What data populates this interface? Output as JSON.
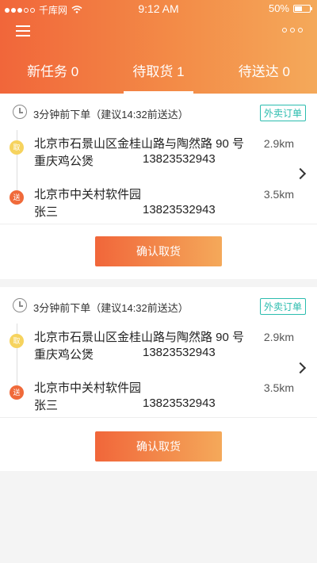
{
  "status_bar": {
    "carrier": "千库网",
    "time": "9:12 AM",
    "battery": "50%"
  },
  "header": {
    "menu_icon": "menu-icon",
    "more_icon": "more-icon"
  },
  "tabs": [
    {
      "label": "新任务 0",
      "active": false
    },
    {
      "label": "待取货 1",
      "active": true
    },
    {
      "label": "待送达 0",
      "active": false
    }
  ],
  "orders": [
    {
      "time_text": "3分钟前下单（建议14:32前送达）",
      "tag": "外卖订单",
      "pickup": {
        "badge": "取",
        "address": "北京市石景山区金桂山路与陶然路 90 号",
        "name": "重庆鸡公煲",
        "phone": "13823532943",
        "distance": "2.9km"
      },
      "dropoff": {
        "badge": "送",
        "address": "北京市中关村软件园",
        "name": "张三",
        "phone": "13823532943",
        "distance": "3.5km"
      },
      "button": "确认取货"
    },
    {
      "time_text": "3分钟前下单（建议14:32前送达）",
      "tag": "外卖订单",
      "pickup": {
        "badge": "取",
        "address": "北京市石景山区金桂山路与陶然路 90 号",
        "name": "重庆鸡公煲",
        "phone": "13823532943",
        "distance": "2.9km"
      },
      "dropoff": {
        "badge": "送",
        "address": "北京市中关村软件园",
        "name": "张三",
        "phone": "13823532943",
        "distance": "3.5km"
      },
      "button": "确认取货"
    }
  ],
  "colors": {
    "accent_start": "#f1663a",
    "accent_end": "#f4a95a",
    "tag": "#2bbcae",
    "pickup_badge": "#f6d35e",
    "dropoff_badge": "#f06a3a"
  }
}
